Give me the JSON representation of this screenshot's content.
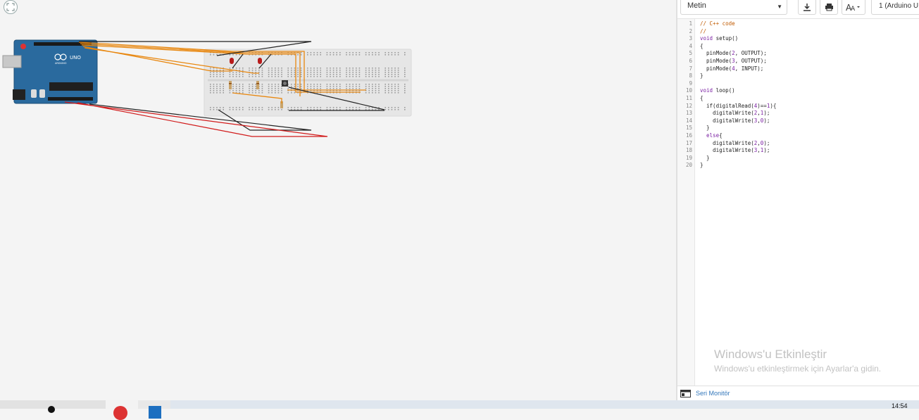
{
  "toolbar": {
    "mode_label": "Metin",
    "device_label": "1 (Arduino U"
  },
  "code": {
    "line_numbers": [
      "1",
      "2",
      "3",
      "4",
      "5",
      "6",
      "7",
      "8",
      "9",
      "10",
      "11",
      "12",
      "13",
      "14",
      "15",
      "16",
      "17",
      "18",
      "19",
      "20"
    ],
    "lines": [
      "// C++ code",
      "//",
      "void setup()",
      "{",
      "  pinMode(2, OUTPUT);",
      "  pinMode(3, OUTPUT);",
      "  pinMode(4, INPUT);",
      "}",
      "",
      "void loop()",
      "{",
      "  if(digitalRead(4)==1){",
      "    digitalWrite(2,1);",
      "    digitalWrite(3,0);",
      "  }",
      "  else{",
      "    digitalWrite(2,0);",
      "    digitalWrite(3,1);",
      "  }",
      "}"
    ]
  },
  "arduino": {
    "logo_text": "UNO",
    "brand_text": "ARDUINO"
  },
  "watermark": {
    "title": "Windows'u Etkinleştir",
    "subtitle": "Windows'u etkinleştirmek için Ayarlar'a gidin."
  },
  "serial_monitor": {
    "label": "Seri Monitör"
  },
  "taskbar": {
    "time": "14:54"
  },
  "colors": {
    "wire_orange": "#e8870f",
    "wire_black": "#222222",
    "wire_red": "#d11a1a",
    "arduino_blue": "#2a6a9e",
    "breadboard": "#e6e6e6"
  },
  "icons": [
    "fit-view-icon",
    "download-icon",
    "print-icon",
    "font-size-icon",
    "serial-monitor-icon"
  ]
}
